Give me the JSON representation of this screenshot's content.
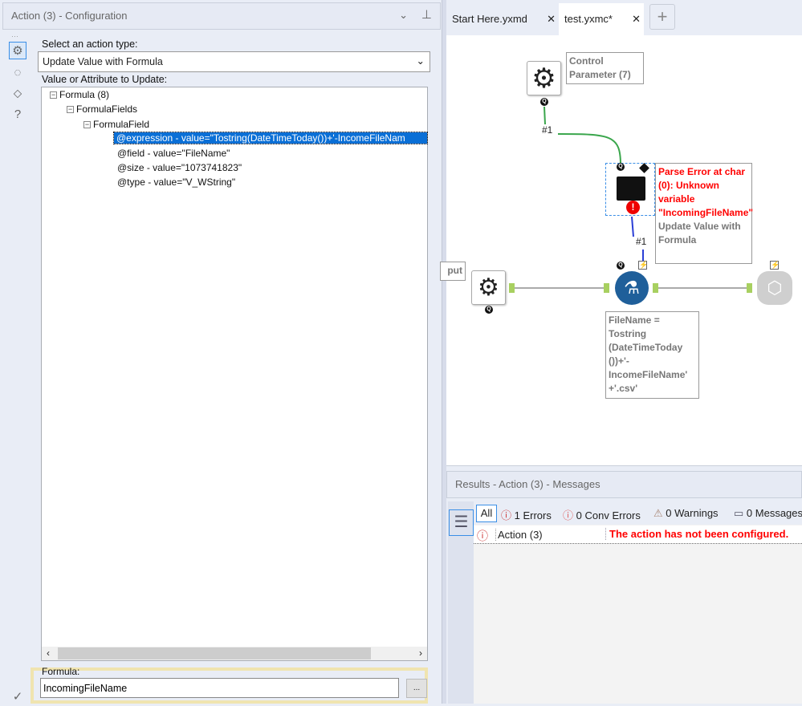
{
  "config_panel": {
    "title": "Action (3) - Configuration",
    "action_type_label": "Select an action type:",
    "action_type_value": "Update Value with Formula",
    "attribute_label": "Value or Attribute to Update:",
    "tree": [
      {
        "label": "Formula (8)"
      },
      {
        "label": "FormulaFields"
      },
      {
        "label": "FormulaField"
      },
      {
        "label": "@expression - value=\"Tostring(DateTimeToday())+'-IncomeFileNam"
      },
      {
        "label": "@field - value=\"FileName\""
      },
      {
        "label": "@size - value=\"1073741823\""
      },
      {
        "label": "@type - value=\"V_WString\""
      }
    ],
    "formula_label": "Formula:",
    "formula_value": "IncomingFileName",
    "browse_label": "..."
  },
  "tabs": [
    {
      "label": "Start Here.yxmd",
      "close": "✕"
    },
    {
      "label": "test.yxmc*",
      "close": "✕",
      "active": true
    }
  ],
  "add_tab": "+",
  "canvas": {
    "control_param_annotation": "Control Parameter (7)",
    "link1": "#1",
    "link2": "#1",
    "error_annotation": "Parse Error at char (0): Unknown variable \"IncomingFileName\"",
    "action_annotation": "Update Value with Formula",
    "input_annotation": "put",
    "formula_annotation": "FileName = Tostring (DateTimeToday ())+'- IncomeFileName' +'.csv'",
    "badge": "Q",
    "bolt": "⚡"
  },
  "results": {
    "title": "Results - Action (3) - Messages",
    "filters": {
      "all": "All",
      "errors": "1 Errors",
      "conv_errors": "0 Conv Errors",
      "warnings": "0 Warnings",
      "messages": "0 Messages"
    },
    "rows": [
      {
        "tool": "Action (3)",
        "message": "The action has not been configured."
      }
    ]
  },
  "colors": {
    "accent": "#0a6fd6",
    "error": "#ff0000",
    "link_green": "#3aa64c",
    "link_blue": "#2b3fd6",
    "formula_tool": "#1f5f9a"
  }
}
